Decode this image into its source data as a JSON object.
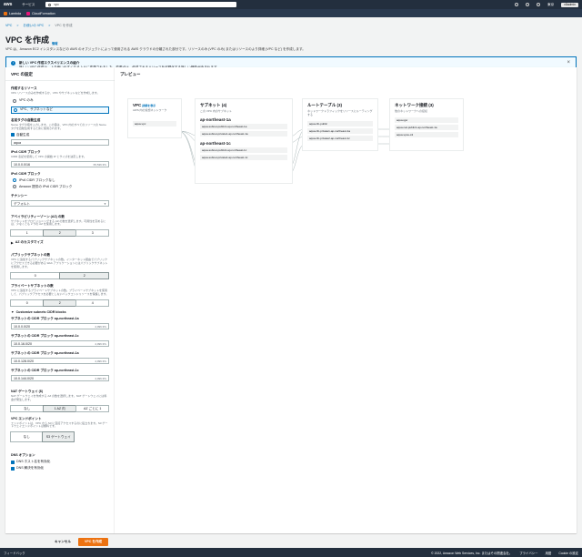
{
  "topbar": {
    "logo": "aws",
    "services": "サービス",
    "search": "vpc",
    "region": "東京",
    "account": "v8admin"
  },
  "favorites": [
    {
      "label": "Lambda",
      "color": "#ec7211"
    },
    {
      "label": "CloudFormation",
      "color": "#e7157b"
    }
  ],
  "breadcrumb": [
    "VPC",
    "お使いの VPC",
    "VPC を作成"
  ],
  "page": {
    "title": "VPC を作成",
    "info": "情報",
    "description": "VPC は、Amazon EC2 インスタンスなどの AWS のオブジェクトによって使用される AWS クラウドの分離された部分です。リソースのみ (VPC のみ) またはリソースのより詳細 (VPC など) を作成します。"
  },
  "alert": {
    "title": "新しい VPC 作成エクスペリエンスの紹介",
    "body": "新しい VPC 作成は、より使いやすくなるように変更されました。変更点は、作成されるリソースを可視化する新しい機能が含まれます。",
    "body2": "古いウィザードを使用するには、ナビゲーションペインで [New VPC Experience] をオフにし、VPC ダッシュボードで [Launch VPC Wizard] を選択します。",
    "link": "ご意見をお寄せください。"
  },
  "settings": {
    "heading": "VPC の設定",
    "resources_label": "作成するリソース",
    "resources_hint": "VPC リソースのみを作成するか、VPC やサブネットなどを作成します。",
    "opt_vpc_only": "VPC のみ",
    "opt_vpc_more": "VPC、サブネットなど",
    "name_tag_label": "名前タグの自動生成",
    "name_tag_hint": "Name タグの値を入力します。この値は、VPC 内のすべてのリソースの Name タグを自動生成するために使用されます。",
    "autogen": "自動生成",
    "name_value": "aqua",
    "ipv4_label": "IPv4 CIDR ブロック",
    "ipv4_hint": "CIDR 表記を使用して VPC の開始 IP とサイズを決定します。",
    "ipv4_value": "10.0.0.0/16",
    "ipv4_suffix": "65,536 IPs",
    "ipv6_label": "IPv6 CIDR ブロック",
    "ipv6_opt1": "IPv6 CIDR ブロックなし",
    "ipv6_opt2": "Amazon 提供の IPv6 CIDR ブロック",
    "tenancy_label": "テナンシー",
    "tenancy_value": "デフォルト",
    "az_label": "アベイラビリティーゾーン (AZ) の数",
    "az_hint": "サブネットをプロビジョニングする AZ の数を選択します。可用性を高めるには、少なくとも 2 つの AZ を使用します。",
    "az_opts": [
      "1",
      "2",
      "3"
    ],
    "az_customize": "AZ のカスタマイズ",
    "pub_label": "パブリックサブネットの数",
    "pub_hint": "VPC に追加するパブリックサブネットの数。インターネット経由でパブリックにアクセスできる必要がある Web アプリケーションにはパブリックサブネットを使用します。",
    "pub_opts": [
      "0",
      "2"
    ],
    "priv_label": "プライベートサブネットの数",
    "priv_hint": "VPC に追加するプライベートサブネットの数。プライベートサブネットを使用して、パブリックアクセスを必要としないバックエンドリソースを保護します。",
    "priv_opts": [
      "0",
      "2",
      "4"
    ],
    "cidr_toggle": "Customize subnets CIDR blocks",
    "cidrs": [
      {
        "label": "サブネットの CIDR ブロック ap-northeast-1a",
        "value": "10.0.0.0/20",
        "ips": "4,096 IPs"
      },
      {
        "label": "サブネットの CIDR ブロック ap-northeast-1c",
        "value": "10.0.16.0/20",
        "ips": "4,096 IPs"
      },
      {
        "label": "サブネットの CIDR ブロック ap-northeast-1a",
        "value": "10.0.128.0/20",
        "ips": "4,096 IPs"
      },
      {
        "label": "サブネットの CIDR ブロック ap-northeast-1c",
        "value": "10.0.144.0/20",
        "ips": "4,096 IPs"
      }
    ],
    "nat_label": "NAT ゲートウェイ ($)",
    "nat_hint": "NAT ゲートウェイを作成する AZ の数を選択します。NAT ゲートウェイには料金が発生します。",
    "nat_opts": [
      "なし",
      "1 AZ 内",
      "AZ ごとに 1"
    ],
    "endpoint_label": "VPC エンドポイント",
    "endpoint_hint": "エンドポイントは、VPC から S3 に直接アクセスするのに役立ちます。S3 ゲートウェイエンドポイントは無料です。",
    "endpoint_opts": [
      "なし",
      "S3 ゲートウェイ"
    ],
    "dns_label": "DNS オプション",
    "dns_opt1": "DNS ホスト名を有効化",
    "dns_opt2": "DNS 解決を有効化"
  },
  "buttons": {
    "cancel": "キャンセル",
    "create": "VPC を作成"
  },
  "preview": {
    "heading": "プレビュー",
    "vpc": {
      "title": "VPC",
      "link": "詳細を表示",
      "sub": "AWS 内の仮想ネットワーク",
      "item": "aqua-vpc"
    },
    "subnets": {
      "title": "サブネット (4)",
      "sub": "この VPC 内のサブネット",
      "az1": "ap-northeast-1a",
      "az1_items": [
        "aqua-subnet-public1-ap-northeast-1a",
        "aqua-subnet-private1-ap-northeast-1a"
      ],
      "az2": "ap-northeast-1c",
      "az2_items": [
        "aqua-subnet-public2-ap-northeast-1c",
        "aqua-subnet-private2-ap-northeast-1c"
      ]
    },
    "routes": {
      "title": "ルートテーブル (3)",
      "sub": "ネットワークトラフィックをリソースにルーティングする",
      "items": [
        "aqua-rtb-public",
        "aqua-rtb-private1-ap-northeast-1a",
        "aqua-rtb-private2-ap-northeast-1c"
      ]
    },
    "network": {
      "title": "ネットワーク接続 (3)",
      "sub": "他のネットワークへの接続",
      "items": [
        "aqua-igw",
        "aqua-nat-public1-ap-northeast-1a",
        "aqua-vpce-s3"
      ]
    }
  },
  "footer": {
    "left": "フィードバック",
    "copyright": "© 2022, Amazon Web Services, Inc. またはその関連会社。",
    "privacy": "プライバシー",
    "terms": "用語",
    "cookie": "Cookie の設定"
  }
}
